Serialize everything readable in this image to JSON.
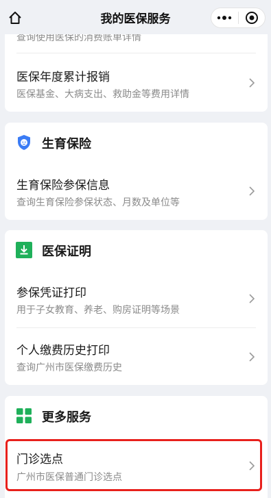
{
  "header": {
    "title": "我的医保服务"
  },
  "card1": {
    "partial_sub": "查询使用医保的消费账单详情",
    "item": {
      "title": "医保年度累计报销",
      "subtitle": "医保基金、大病支出、救助金等费用详情"
    }
  },
  "maternity": {
    "heading": "生育保险",
    "item": {
      "title": "生育保险参保信息",
      "subtitle": "查询生育保险参保状态、月数及单位等"
    }
  },
  "certificate": {
    "heading": "医保证明",
    "items": [
      {
        "title": "参保凭证打印",
        "subtitle": "用于子女教育、养老、购房证明等场景"
      },
      {
        "title": "个人缴费历史打印",
        "subtitle": "查询广州市医保缴费历史"
      }
    ]
  },
  "more": {
    "heading": "更多服务",
    "item": {
      "title": "门诊选点",
      "subtitle": "广州市医保普通门诊选点"
    }
  },
  "colors": {
    "accent_blue": "#3b7cf5",
    "accent_green": "#1fb05a",
    "highlight_red": "#e8201c"
  }
}
